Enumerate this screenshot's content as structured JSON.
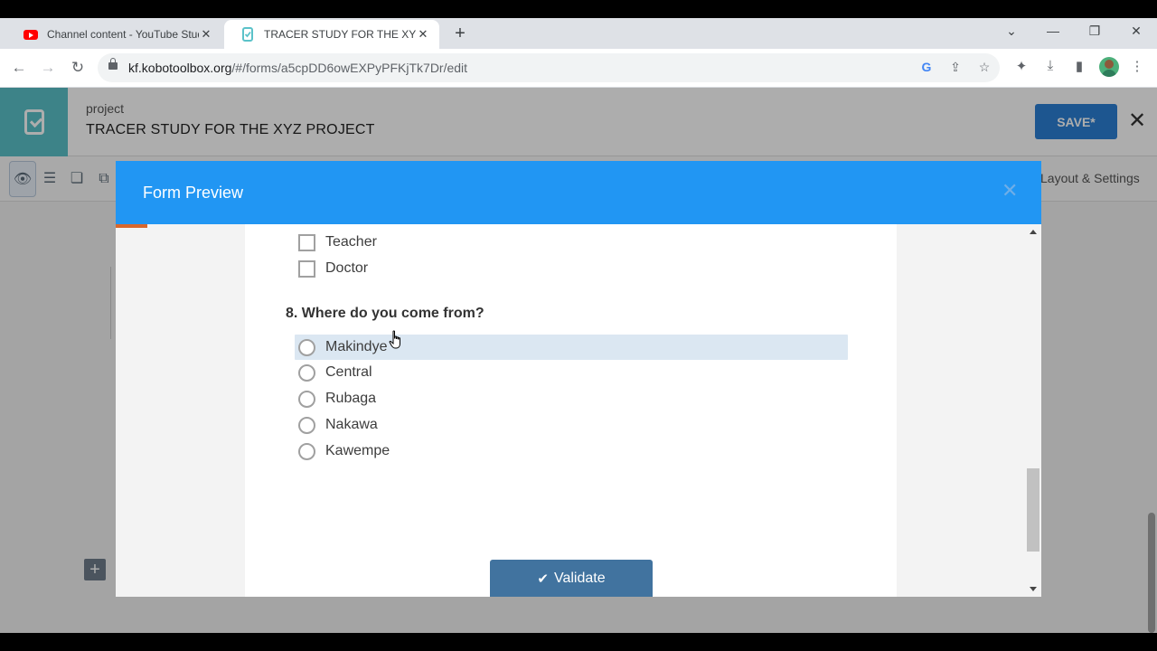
{
  "browser": {
    "tabs": [
      {
        "title": "Channel content - YouTube Studio",
        "favicon": "youtube-icon"
      },
      {
        "title": "TRACER STUDY FOR THE XYZ PROJECT",
        "favicon": "kobo-icon"
      }
    ],
    "url_domain": "kf.kobotoolbox.org",
    "url_path": "/#/forms/a5cpDD6owEXPyPFKjTk7Dr/edit"
  },
  "app": {
    "project_label": "project",
    "project_title": "TRACER STUDY FOR THE XYZ PROJECT",
    "save_label": "SAVE*",
    "layout_settings_label": "Layout & Settings",
    "accent_color": "#2196f3"
  },
  "modal": {
    "title": "Form Preview",
    "prev_options": [
      "Teacher",
      "Doctor"
    ],
    "question": "8. Where do you come from?",
    "options": [
      "Makindye",
      "Central",
      "Rubaga",
      "Nakawa",
      "Kawempe"
    ],
    "hovered_option": "Makindye",
    "validate_label": "Validate"
  }
}
